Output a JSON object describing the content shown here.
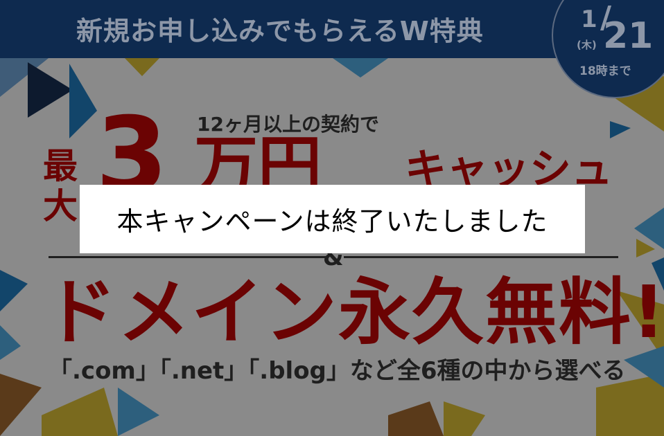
{
  "banner": {
    "title": "新規お申し込みでもらえるW特典",
    "date": {
      "month": "1",
      "slash": "/",
      "day": "21",
      "weekday": "(木)",
      "time": "18時まで"
    },
    "subhead": "12ヶ月以上の契約で",
    "max_label": "最大",
    "amount_number": "3",
    "amount_unit": "万円",
    "cashback": "キャッシュ",
    "ampersand": "&",
    "domain_free": "ドメイン永久無料!",
    "tld_line": "「.com」「.net」「.blog」など全6種の中から選べる"
  },
  "overlay": {
    "message": "本キャンペーンは終了いたしました"
  },
  "colors": {
    "navy": "#0e2a4f",
    "maroon": "#6b0303",
    "dim_gray": "#8a8a8a",
    "overlay_bg": "#ffffff"
  }
}
